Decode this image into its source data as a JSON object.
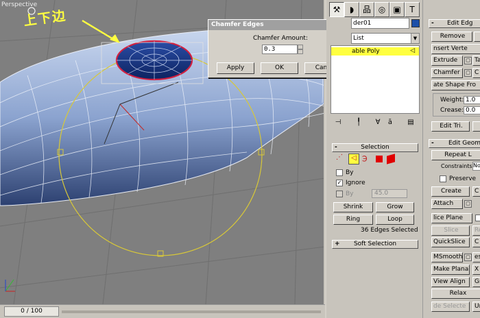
{
  "viewport": {
    "label": "Perspective",
    "annotation": "上下边"
  },
  "timeline": {
    "slider_text": "0 / 100"
  },
  "dialog": {
    "title": "Chamfer Edges",
    "close": "×",
    "amount_label": "Chamfer Amount:",
    "amount_value": "0.3",
    "apply": "Apply",
    "ok": "OK",
    "cancel": "Cancel"
  },
  "command_panel": {
    "tabs": [
      {
        "icon": "create-icon",
        "glyph": "⚒"
      },
      {
        "icon": "modify-icon",
        "glyph": "◗"
      },
      {
        "icon": "hierarchy-icon",
        "glyph": "品"
      },
      {
        "icon": "motion-icon",
        "glyph": "◎"
      },
      {
        "icon": "display-icon",
        "glyph": "▣"
      },
      {
        "icon": "utilities-icon",
        "glyph": "T"
      }
    ],
    "object_name": "der01",
    "object_color": "#1c4fa8",
    "modifier_list": "List",
    "stack_item": "able Poly",
    "stack_icons": [
      "pin-icon",
      "show-end-result-icon",
      "make-unique-icon",
      "remove-modifier-icon",
      "configure-icon"
    ],
    "stack_glyphs": [
      "⊣",
      "╿",
      "∀",
      "ā",
      "▤"
    ]
  },
  "selection": {
    "title": "Selection",
    "by_vertex": "By",
    "ignore_backfacing": "Ignore",
    "by_angle": "By",
    "angle_value": "45.0",
    "shrink": "Shrink",
    "grow": "Grow",
    "ring": "Ring",
    "loop": "Loop",
    "status": "36 Edges Selected"
  },
  "soft_selection": {
    "title": "Soft Selection"
  },
  "edit_edges": {
    "title": "Edit Edg",
    "remove": "Remove",
    "insert_vertex": "nsert Verte",
    "extrude": "Extrude",
    "weld": "Ta",
    "chamfer": "Chamfer",
    "connect": "C",
    "create_shape": "ate Shape Fro",
    "weight_label": "Weight:",
    "weight_value": "1.0",
    "crease_label": "Crease:",
    "crease_value": "0.0",
    "edit_tri": "Edit Tri."
  },
  "edit_geometry": {
    "title": "Edit Geom",
    "repeat_last": "Repeat L",
    "constraints_label": "Constraints:",
    "constraints_value": "No",
    "preserve_uvs": "Preserve",
    "create": "Create",
    "collapse": "C",
    "attach": "Attach",
    "slice_plane": "lice Plane",
    "slice": "Slice",
    "reset_plane": "Re",
    "quickslice": "QuickSlice",
    "cut": "C",
    "msmooth": "MSmooth",
    "tessellate": "es",
    "make_planar": "Make Planar",
    "x": "X",
    "view_align": "View Align",
    "grid_align": "Gr",
    "relax": "Relax",
    "hide_selected": "de Selecte",
    "unhide": "Un"
  }
}
